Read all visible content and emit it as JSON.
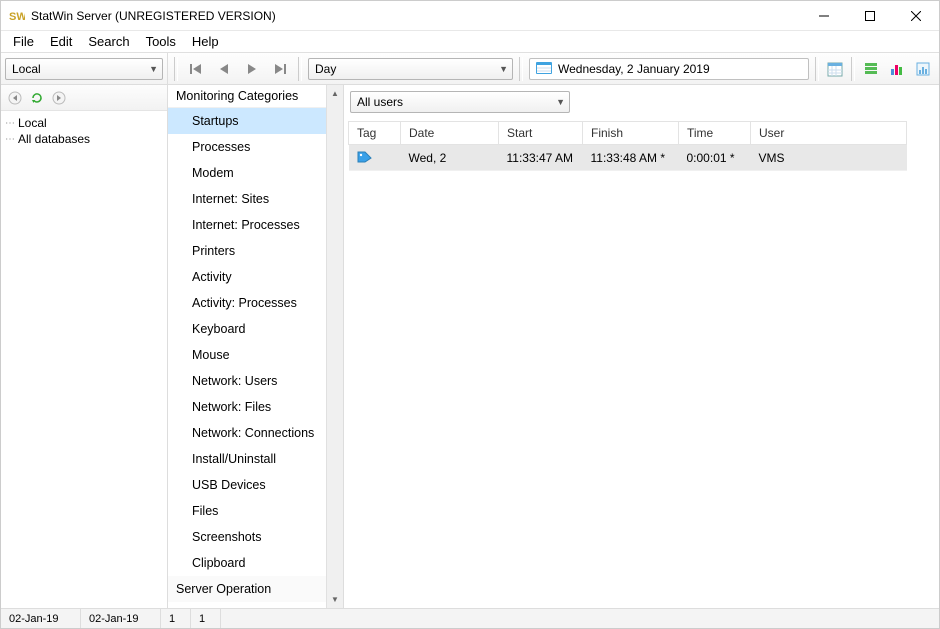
{
  "title": "StatWin Server (UNREGISTERED VERSION)",
  "menu": {
    "file": "File",
    "edit": "Edit",
    "search": "Search",
    "tools": "Tools",
    "help": "Help"
  },
  "left_combo": {
    "value": "Local"
  },
  "period_combo": {
    "value": "Day"
  },
  "date_display": "Wednesday, 2 January 2019",
  "tree": {
    "items": [
      "Local",
      "All databases"
    ]
  },
  "mid": {
    "header": "Monitoring Categories",
    "items": [
      "Startups",
      "Processes",
      "Modem",
      "Internet: Sites",
      "Internet: Processes",
      "Printers",
      "Activity",
      "Activity: Processes",
      "Keyboard",
      "Mouse",
      "Network: Users",
      "Network: Files",
      "Network: Connections",
      "Install/Uninstall",
      "USB Devices",
      "Files",
      "Screenshots",
      "Clipboard"
    ],
    "section": "Server Operation",
    "selected_index": 0
  },
  "filter": {
    "users_value": "All users"
  },
  "table": {
    "headers": {
      "tag": "Tag",
      "date": "Date",
      "start": "Start",
      "finish": "Finish",
      "time": "Time",
      "user": "User"
    },
    "rows": [
      {
        "date": "Wed, 2",
        "start": "11:33:47 AM",
        "finish": "11:33:48 AM *",
        "time": "0:00:01 *",
        "user": "VMS"
      }
    ]
  },
  "status": {
    "date1": "02-Jan-19",
    "date2": "02-Jan-19",
    "count1": "1",
    "count2": "1"
  }
}
